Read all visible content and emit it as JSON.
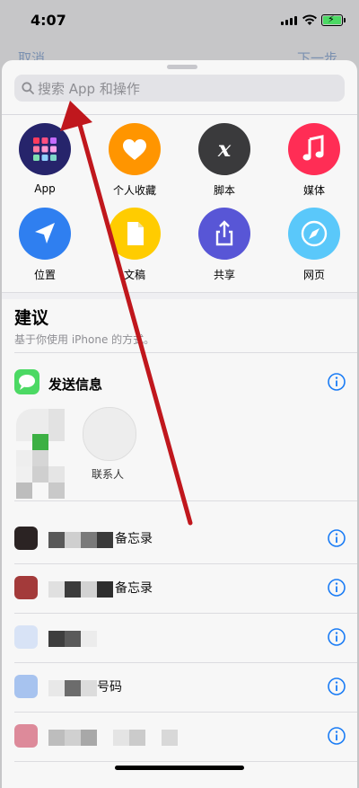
{
  "status_bar": {
    "time": "4:07"
  },
  "behind": {
    "left_label": "取消",
    "right_label": "下一步"
  },
  "search": {
    "placeholder": "搜索 App 和操作"
  },
  "categories": [
    {
      "label": "App",
      "color": "#26246b",
      "icon": "app-grid-icon"
    },
    {
      "label": "个人收藏",
      "color": "#ff9500",
      "icon": "heart-icon"
    },
    {
      "label": "脚本",
      "color": "#3a3a3c",
      "icon": "script-x-icon"
    },
    {
      "label": "媒体",
      "color": "#ff2d55",
      "icon": "music-note-icon"
    },
    {
      "label": "位置",
      "color": "#2f7ff0",
      "icon": "location-arrow-icon"
    },
    {
      "label": "文稿",
      "color": "#ffcc00",
      "icon": "document-icon"
    },
    {
      "label": "共享",
      "color": "#5856d6",
      "icon": "share-icon"
    },
    {
      "label": "网页",
      "color": "#5ac8fa",
      "icon": "compass-icon"
    }
  ],
  "suggestions": {
    "title": "建议",
    "subtitle": "基于你使用 iPhone 的方式。",
    "first_item": {
      "label": "发送信息",
      "icon": "messages-icon"
    },
    "contact_label": "联系人",
    "rows": [
      {
        "text": "备忘录",
        "thumb_color": "#3a2b2b"
      },
      {
        "text": "备忘录",
        "thumb_color": "#a33a3a"
      },
      {
        "text": "",
        "thumb_color": "#d8e3f6"
      },
      {
        "text": "号码",
        "thumb_color": "#a7c3ef"
      },
      {
        "text": "",
        "thumb_color": "#dd8a9a"
      }
    ]
  },
  "colors": {
    "accent": "#1a7cf5",
    "annotation": "#c0171d"
  }
}
